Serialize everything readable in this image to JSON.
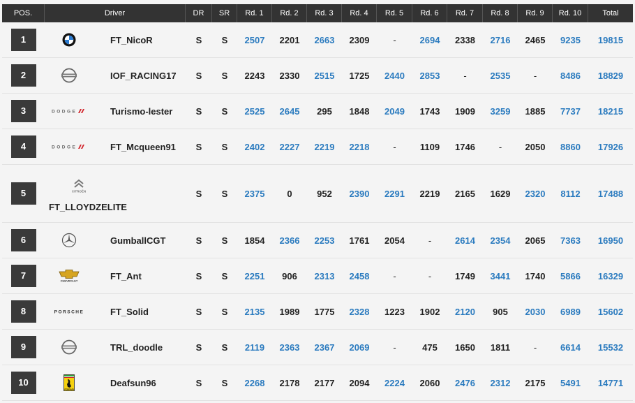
{
  "headers": [
    "POS.",
    "Driver",
    "DR",
    "SR",
    "Rd. 1",
    "Rd. 2",
    "Rd. 3",
    "Rd. 4",
    "Rd. 5",
    "Rd. 6",
    "Rd. 7",
    "Rd. 8",
    "Rd. 9",
    "Rd. 10",
    "Total"
  ],
  "colors": {
    "header_bg": "#333333",
    "pos_bg": "#3a3a3a",
    "highlight": "#2b7bbf",
    "row_bg": "#f4f4f4"
  },
  "rows": [
    {
      "pos": "1",
      "logo": "bmw-logo-icon",
      "driver": "FT_NicoR",
      "dr": "S",
      "sr": "S",
      "rounds": [
        [
          "2507",
          true
        ],
        [
          "2201",
          false
        ],
        [
          "2663",
          true
        ],
        [
          "2309",
          false
        ],
        [
          "-",
          false
        ],
        [
          "2694",
          true
        ],
        [
          "2338",
          false
        ],
        [
          "2716",
          true
        ],
        [
          "2465",
          false
        ],
        [
          "9235",
          true
        ]
      ],
      "total": "19815"
    },
    {
      "pos": "2",
      "logo": "nissan-logo-icon",
      "driver": "IOF_RACING17",
      "dr": "S",
      "sr": "S",
      "rounds": [
        [
          "2243",
          false
        ],
        [
          "2330",
          false
        ],
        [
          "2515",
          true
        ],
        [
          "1725",
          false
        ],
        [
          "2440",
          true
        ],
        [
          "2853",
          true
        ],
        [
          "-",
          false
        ],
        [
          "2535",
          true
        ],
        [
          "-",
          false
        ],
        [
          "8486",
          true
        ]
      ],
      "total": "18829"
    },
    {
      "pos": "3",
      "logo": "dodge-logo-icon",
      "driver": "Turismo-lester",
      "dr": "S",
      "sr": "S",
      "rounds": [
        [
          "2525",
          true
        ],
        [
          "2645",
          true
        ],
        [
          "295",
          false
        ],
        [
          "1848",
          false
        ],
        [
          "2049",
          true
        ],
        [
          "1743",
          false
        ],
        [
          "1909",
          false
        ],
        [
          "3259",
          true
        ],
        [
          "1885",
          false
        ],
        [
          "7737",
          true
        ]
      ],
      "total": "18215"
    },
    {
      "pos": "4",
      "logo": "dodge-logo-icon",
      "driver": "FT_Mcqueen91",
      "dr": "S",
      "sr": "S",
      "rounds": [
        [
          "2402",
          true
        ],
        [
          "2227",
          true
        ],
        [
          "2219",
          true
        ],
        [
          "2218",
          true
        ],
        [
          "-",
          false
        ],
        [
          "1109",
          false
        ],
        [
          "1746",
          false
        ],
        [
          "-",
          false
        ],
        [
          "2050",
          false
        ],
        [
          "8860",
          true
        ]
      ],
      "total": "17926"
    },
    {
      "pos": "5",
      "logo": "citroen-logo-icon",
      "driver": "FT_LLOYDZELITE",
      "dr": "S",
      "sr": "S",
      "rounds": [
        [
          "2375",
          true
        ],
        [
          "0",
          false
        ],
        [
          "952",
          false
        ],
        [
          "2390",
          true
        ],
        [
          "2291",
          true
        ],
        [
          "2219",
          false
        ],
        [
          "2165",
          false
        ],
        [
          "1629",
          false
        ],
        [
          "2320",
          true
        ],
        [
          "8112",
          true
        ]
      ],
      "total": "17488"
    },
    {
      "pos": "6",
      "logo": "mercedes-logo-icon",
      "driver": "GumballCGT",
      "dr": "S",
      "sr": "S",
      "rounds": [
        [
          "1854",
          false
        ],
        [
          "2366",
          true
        ],
        [
          "2253",
          true
        ],
        [
          "1761",
          false
        ],
        [
          "2054",
          false
        ],
        [
          "-",
          false
        ],
        [
          "2614",
          true
        ],
        [
          "2354",
          true
        ],
        [
          "2065",
          false
        ],
        [
          "7363",
          true
        ]
      ],
      "total": "16950"
    },
    {
      "pos": "7",
      "logo": "chevrolet-logo-icon",
      "driver": "FT_Ant",
      "dr": "S",
      "sr": "S",
      "rounds": [
        [
          "2251",
          true
        ],
        [
          "906",
          false
        ],
        [
          "2313",
          true
        ],
        [
          "2458",
          true
        ],
        [
          "-",
          false
        ],
        [
          "-",
          false
        ],
        [
          "1749",
          false
        ],
        [
          "3441",
          true
        ],
        [
          "1740",
          false
        ],
        [
          "5866",
          true
        ]
      ],
      "total": "16329"
    },
    {
      "pos": "8",
      "logo": "porsche-logo-icon",
      "driver": "FT_Solid",
      "dr": "S",
      "sr": "S",
      "rounds": [
        [
          "2135",
          true
        ],
        [
          "1989",
          false
        ],
        [
          "1775",
          false
        ],
        [
          "2328",
          true
        ],
        [
          "1223",
          false
        ],
        [
          "1902",
          false
        ],
        [
          "2120",
          true
        ],
        [
          "905",
          false
        ],
        [
          "2030",
          true
        ],
        [
          "6989",
          true
        ]
      ],
      "total": "15602"
    },
    {
      "pos": "9",
      "logo": "nissan-logo-icon",
      "driver": "TRL_doodle",
      "dr": "S",
      "sr": "S",
      "rounds": [
        [
          "2119",
          true
        ],
        [
          "2363",
          true
        ],
        [
          "2367",
          true
        ],
        [
          "2069",
          true
        ],
        [
          "-",
          false
        ],
        [
          "475",
          false
        ],
        [
          "1650",
          false
        ],
        [
          "1811",
          false
        ],
        [
          "-",
          false
        ],
        [
          "6614",
          true
        ]
      ],
      "total": "15532"
    },
    {
      "pos": "10",
      "logo": "ferrari-logo-icon",
      "driver": "Deafsun96",
      "dr": "S",
      "sr": "S",
      "rounds": [
        [
          "2268",
          true
        ],
        [
          "2178",
          false
        ],
        [
          "2177",
          false
        ],
        [
          "2094",
          false
        ],
        [
          "2224",
          true
        ],
        [
          "2060",
          false
        ],
        [
          "2476",
          true
        ],
        [
          "2312",
          true
        ],
        [
          "2175",
          false
        ],
        [
          "5491",
          true
        ]
      ],
      "total": "14771"
    }
  ]
}
